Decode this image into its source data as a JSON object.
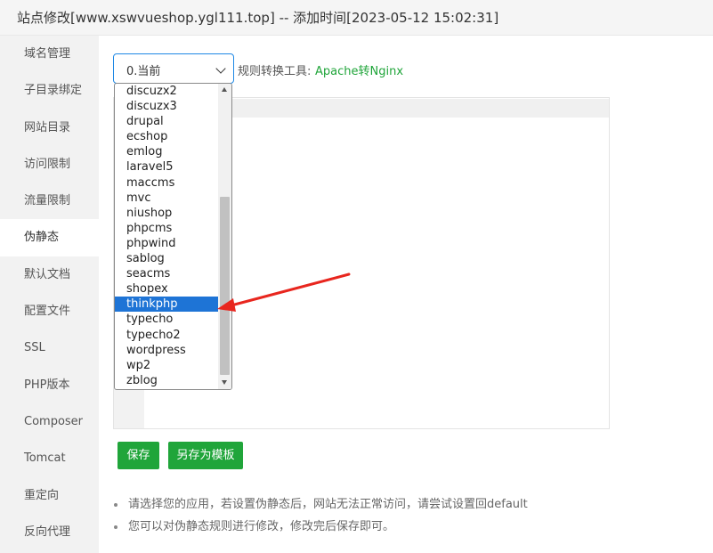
{
  "window": {
    "title": "站点修改[www.xswvueshop.ygl111.top] -- 添加时间[2023-05-12 15:02:31]"
  },
  "sidebar": {
    "items": [
      {
        "label": "域名管理"
      },
      {
        "label": "子目录绑定"
      },
      {
        "label": "网站目录"
      },
      {
        "label": "访问限制"
      },
      {
        "label": "流量限制"
      },
      {
        "label": "伪静态"
      },
      {
        "label": "默认文档"
      },
      {
        "label": "配置文件"
      },
      {
        "label": "SSL"
      },
      {
        "label": "PHP版本"
      },
      {
        "label": "Composer"
      },
      {
        "label": "Tomcat"
      },
      {
        "label": "重定向"
      },
      {
        "label": "反向代理"
      }
    ],
    "active_index": 5
  },
  "rewrite": {
    "selected_value": "0.当前",
    "tool_label": "规则转换工具:",
    "tool_link": "Apache转Nginx",
    "options": [
      "discuzx2",
      "discuzx3",
      "drupal",
      "ecshop",
      "emlog",
      "laravel5",
      "maccms",
      "mvc",
      "niushop",
      "phpcms",
      "phpwind",
      "sablog",
      "seacms",
      "shopex",
      "thinkphp",
      "typecho",
      "typecho2",
      "wordpress",
      "wp2",
      "zblog"
    ],
    "highlighted_option": "thinkphp",
    "save_label": "保存",
    "save_template_label": "另存为模板"
  },
  "tips": [
    "请选择您的应用，若设置伪静态后，网站无法正常访问，请尝试设置回default",
    "您可以对伪静态规则进行修改，修改完后保存即可。"
  ],
  "colors": {
    "accent_green": "#20a53a",
    "select_border": "#1e88e5",
    "highlight_blue": "#1e74d6",
    "annotation_red": "#e8261e"
  }
}
